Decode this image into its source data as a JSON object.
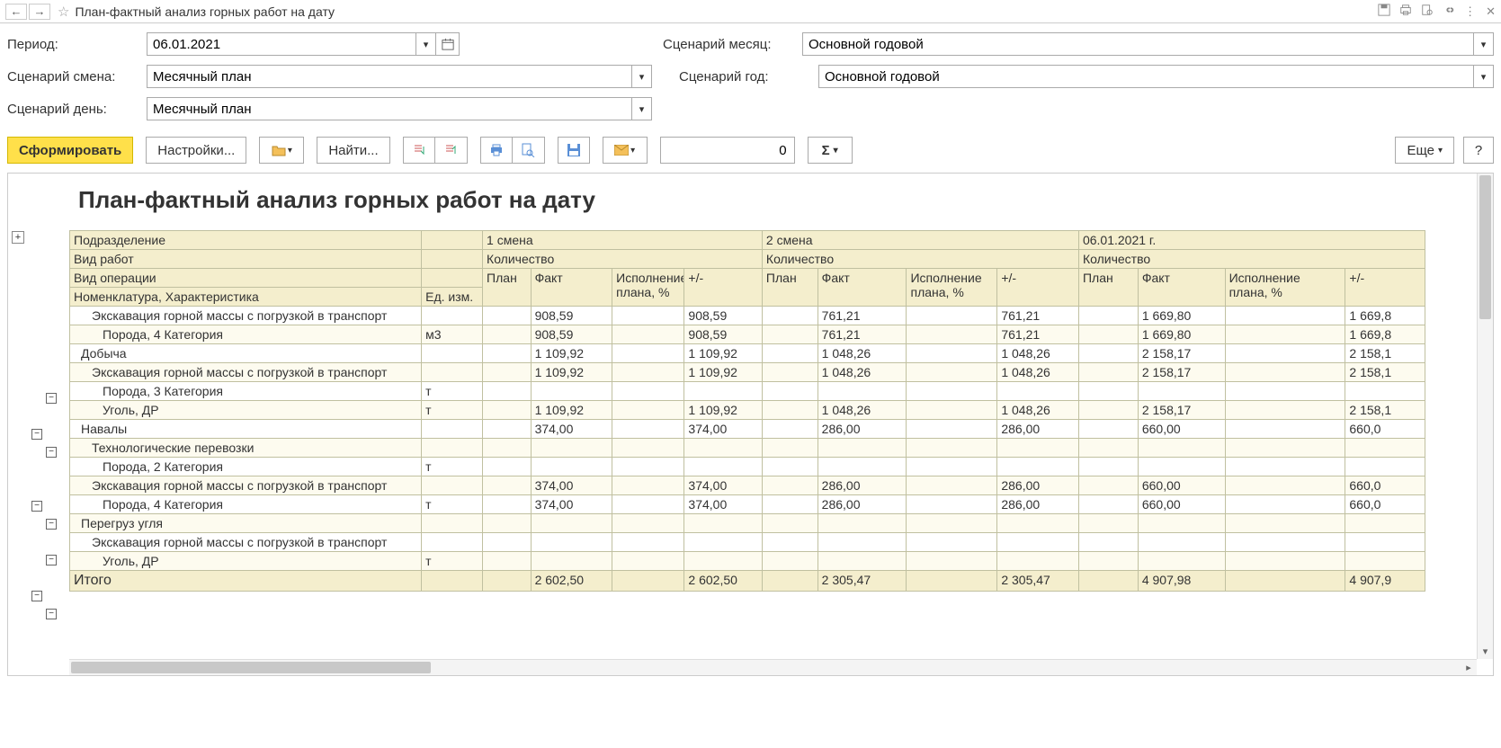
{
  "title": "План-фактный анализ горных работ на дату",
  "filters": {
    "period_label": "Период:",
    "period_value": "06.01.2021",
    "scen_shift_label": "Сценарий смена:",
    "scen_shift_value": "Месячный план",
    "scen_day_label": "Сценарий день:",
    "scen_day_value": "Месячный план",
    "scen_month_label": "Сценарий месяц:",
    "scen_month_value": "Основной годовой",
    "scen_year_label": "Сценарий год:",
    "scen_year_value": "Основной годовой"
  },
  "toolbar": {
    "generate": "Сформировать",
    "settings": "Настройки...",
    "find": "Найти...",
    "more": "Еще",
    "help": "?",
    "numeric_value": "0",
    "sigma": "Σ"
  },
  "report": {
    "heading": "План-фактный анализ горных работ на дату",
    "hdr_subdiv": "Подразделение",
    "hdr_worktype": "Вид работ",
    "hdr_operation": "Вид операции",
    "hdr_nomen": "Номенклатура, Характеристика",
    "hdr_unit": "Ед. изм.",
    "hdr_shift1": "1 смена",
    "hdr_shift2": "2 смена",
    "hdr_date": "06.01.2021 г.",
    "hdr_qty": "Количество",
    "hdr_plan": "План",
    "hdr_fact": "Факт",
    "hdr_exec": "Исполнение плана, %",
    "hdr_exec2": "Исполнение плана, %",
    "hdr_exec3": "Исполнение плана, %",
    "hdr_pm": "+/-",
    "total_label": "Итого"
  },
  "rows": [
    {
      "even": false,
      "indent": 2,
      "label": "Экскавация горной массы с погрузкой в транспорт",
      "unit": "",
      "s1_fact": "908,59",
      "s1_pm": "908,59",
      "s2_fact": "761,21",
      "s2_pm": "761,21",
      "d_fact": "1 669,80",
      "d_pm": "1 669,8"
    },
    {
      "even": true,
      "indent": 3,
      "label": "Порода, 4 Категория",
      "unit": "м3",
      "s1_fact": "908,59",
      "s1_pm": "908,59",
      "s2_fact": "761,21",
      "s2_pm": "761,21",
      "d_fact": "1 669,80",
      "d_pm": "1 669,8"
    },
    {
      "even": false,
      "indent": 1,
      "label": "Добыча",
      "unit": "",
      "s1_fact": "1 109,92",
      "s1_pm": "1 109,92",
      "s2_fact": "1 048,26",
      "s2_pm": "1 048,26",
      "d_fact": "2 158,17",
      "d_pm": "2 158,1"
    },
    {
      "even": true,
      "indent": 2,
      "label": "Экскавация горной массы с погрузкой в транспорт",
      "unit": "",
      "s1_fact": "1 109,92",
      "s1_pm": "1 109,92",
      "s2_fact": "1 048,26",
      "s2_pm": "1 048,26",
      "d_fact": "2 158,17",
      "d_pm": "2 158,1"
    },
    {
      "even": false,
      "indent": 3,
      "label": "Порода, 3 Категория",
      "unit": "т",
      "s1_fact": "",
      "s1_pm": "",
      "s2_fact": "",
      "s2_pm": "",
      "d_fact": "",
      "d_pm": ""
    },
    {
      "even": true,
      "indent": 3,
      "label": "Уголь, ДР",
      "unit": "т",
      "s1_fact": "1 109,92",
      "s1_pm": "1 109,92",
      "s2_fact": "1 048,26",
      "s2_pm": "1 048,26",
      "d_fact": "2 158,17",
      "d_pm": "2 158,1"
    },
    {
      "even": false,
      "indent": 1,
      "label": "Навалы",
      "unit": "",
      "s1_fact": "374,00",
      "s1_pm": "374,00",
      "s2_fact": "286,00",
      "s2_pm": "286,00",
      "d_fact": "660,00",
      "d_pm": "660,0"
    },
    {
      "even": true,
      "indent": 2,
      "label": "Технологические перевозки",
      "unit": "",
      "s1_fact": "",
      "s1_pm": "",
      "s2_fact": "",
      "s2_pm": "",
      "d_fact": "",
      "d_pm": ""
    },
    {
      "even": false,
      "indent": 3,
      "label": "Порода, 2 Категория",
      "unit": "т",
      "s1_fact": "",
      "s1_pm": "",
      "s2_fact": "",
      "s2_pm": "",
      "d_fact": "",
      "d_pm": ""
    },
    {
      "even": true,
      "indent": 2,
      "label": "Экскавация горной массы с погрузкой в транспорт",
      "unit": "",
      "s1_fact": "374,00",
      "s1_pm": "374,00",
      "s2_fact": "286,00",
      "s2_pm": "286,00",
      "d_fact": "660,00",
      "d_pm": "660,0"
    },
    {
      "even": false,
      "indent": 3,
      "label": "Порода, 4 Категория",
      "unit": "т",
      "s1_fact": "374,00",
      "s1_pm": "374,00",
      "s2_fact": "286,00",
      "s2_pm": "286,00",
      "d_fact": "660,00",
      "d_pm": "660,0"
    },
    {
      "even": true,
      "indent": 1,
      "label": "Перегруз угля",
      "unit": "",
      "s1_fact": "",
      "s1_pm": "",
      "s2_fact": "",
      "s2_pm": "",
      "d_fact": "",
      "d_pm": ""
    },
    {
      "even": false,
      "indent": 2,
      "label": "Экскавация горной массы с погрузкой в транспорт",
      "unit": "",
      "s1_fact": "",
      "s1_pm": "",
      "s2_fact": "",
      "s2_pm": "",
      "d_fact": "",
      "d_pm": ""
    },
    {
      "even": true,
      "indent": 3,
      "label": "Уголь, ДР",
      "unit": "т",
      "s1_fact": "",
      "s1_pm": "",
      "s2_fact": "",
      "s2_pm": "",
      "d_fact": "",
      "d_pm": ""
    }
  ],
  "totals": {
    "s1_fact": "2 602,50",
    "s1_pm": "2 602,50",
    "s2_fact": "2 305,47",
    "s2_pm": "2 305,47",
    "d_fact": "4 907,98",
    "d_pm": "4 907,9"
  }
}
